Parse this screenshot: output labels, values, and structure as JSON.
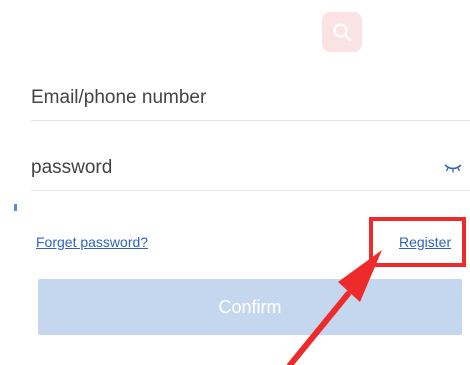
{
  "login_form": {
    "email_placeholder": "Email/phone number",
    "password_placeholder": "password",
    "forget_password_label": "Forget password?",
    "register_label": "Register",
    "confirm_label": "Confirm"
  },
  "icons": {
    "app_logo": "search-icon",
    "password_toggle": "eye-closed-icon"
  },
  "colors": {
    "link": "#2f63b8",
    "confirm_background": "#c5d6ef",
    "annotation": "#ee2b2b"
  }
}
